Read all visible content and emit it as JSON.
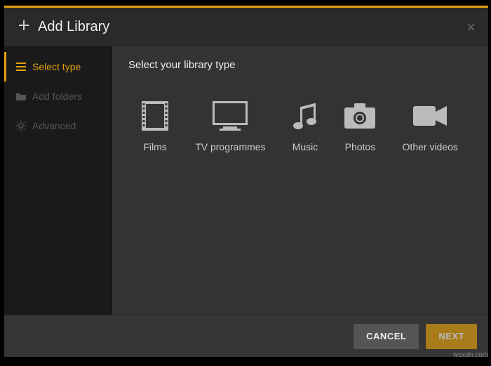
{
  "header": {
    "title": "Add Library"
  },
  "sidebar": {
    "items": [
      {
        "label": "Select type",
        "icon": "list-icon",
        "active": true
      },
      {
        "label": "Add folders",
        "icon": "folder-icon",
        "active": false
      },
      {
        "label": "Advanced",
        "icon": "gear-icon",
        "active": false
      }
    ]
  },
  "main": {
    "heading": "Select your library type",
    "types": [
      {
        "label": "Films",
        "icon": "film-icon"
      },
      {
        "label": "TV programmes",
        "icon": "tv-icon"
      },
      {
        "label": "Music",
        "icon": "music-icon"
      },
      {
        "label": "Photos",
        "icon": "camera-icon"
      },
      {
        "label": "Other videos",
        "icon": "video-icon"
      }
    ]
  },
  "footer": {
    "cancel_label": "CANCEL",
    "next_label": "NEXT"
  },
  "watermark": "wsxdn.com"
}
